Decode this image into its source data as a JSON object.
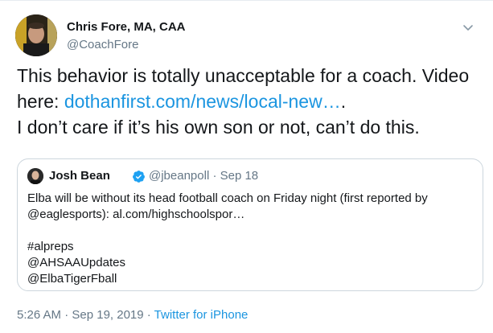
{
  "author": {
    "name": "Chris Fore, MA, CAA",
    "handle": "@CoachFore"
  },
  "tweet": {
    "line1": "This behavior is totally unacceptable for a coach. Video",
    "line2_prefix": "here: ",
    "link": "dothanfirst.com/news/local-new…",
    "line2_suffix": ".",
    "line3": "I don’t care if it’s his own son or not, can’t do this."
  },
  "quoted": {
    "name": "Josh Bean",
    "handle_date": "@jbeanpoll · Sep 18",
    "line1": "Elba will be without its head football coach on Friday night (first reported by",
    "line2": "@eaglesports): al.com/highschoolspor…",
    "line4": "#alpreps",
    "line5": "@AHSAAUpdates",
    "line6": "@ElbaTigerFball"
  },
  "meta": {
    "timestamp": "5:26 AM · Sep 19, 2019 · ",
    "source": "Twitter for iPhone"
  },
  "colors": {
    "link": "#1b95e0",
    "secondary_text": "#657786",
    "border": "#ccd6dd",
    "verified": "#1da1f2"
  },
  "icons": {
    "more": "chevron-down-icon",
    "verified": "verified-badge-icon"
  }
}
